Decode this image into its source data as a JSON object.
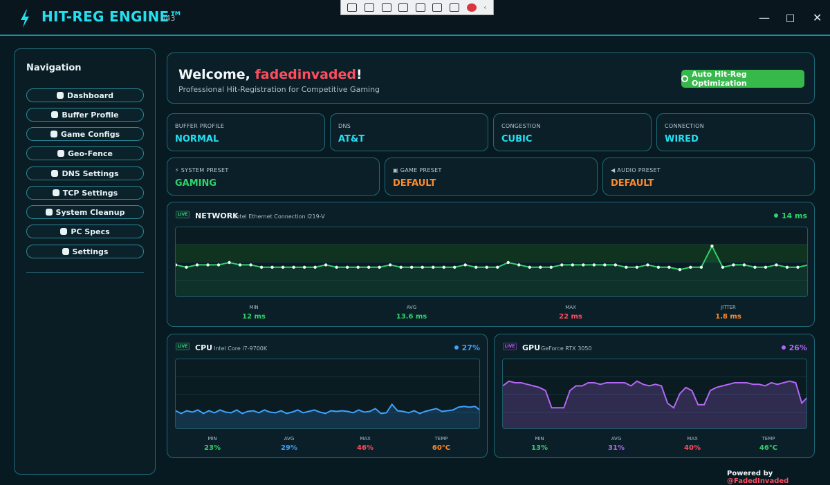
{
  "app": {
    "title": "HIT-REG ENGINE™",
    "version": "v43"
  },
  "window_controls": {
    "minimize": "—",
    "maximize": "□",
    "close": "✕"
  },
  "colors": {
    "accent": "#23e0f0",
    "green": "#2fd36b",
    "orange": "#ff8a2a",
    "red": "#ff4d5e",
    "blue": "#3fa2ff",
    "purple": "#b467f5"
  },
  "nav": {
    "title": "Navigation",
    "items": [
      {
        "label": "Dashboard",
        "icon": "home-icon"
      },
      {
        "label": "Buffer Profile",
        "icon": "gauge-icon"
      },
      {
        "label": "Game Configs",
        "icon": "gamepad-icon"
      },
      {
        "label": "Geo-Fence",
        "icon": "globe-icon"
      },
      {
        "label": "DNS Settings",
        "icon": "dns-icon"
      },
      {
        "label": "TCP Settings",
        "icon": "network-icon"
      },
      {
        "label": "System Cleanup",
        "icon": "broom-icon"
      },
      {
        "label": "PC Specs",
        "icon": "monitor-icon"
      },
      {
        "label": "Settings",
        "icon": "gear-icon"
      }
    ]
  },
  "welcome": {
    "greeting": "Welcome, ",
    "username": "fadedinvaded",
    "suffix": "!",
    "subtitle": "Professional Hit-Registration for Competitive Gaming",
    "button": "Auto Hit-Reg Optimization"
  },
  "stats_row1": [
    {
      "label": "BUFFER PROFILE",
      "value": "NORMAL"
    },
    {
      "label": "DNS",
      "value": "AT&T"
    },
    {
      "label": "CONGESTION",
      "value": "CUBIC"
    },
    {
      "label": "CONNECTION",
      "value": "WIRED"
    }
  ],
  "stats_row2": [
    {
      "label": "SYSTEM PRESET",
      "value": "GAMING"
    },
    {
      "label": "GAME PRESET",
      "value": "DEFAULT"
    },
    {
      "label": "AUDIO PRESET",
      "value": "DEFAULT"
    }
  ],
  "network": {
    "live": "LIVE",
    "title": "NETWORK",
    "subtitle": "Intel Ethernet Connection I219-V",
    "reading": "14 ms",
    "metrics": [
      {
        "label": "MIN",
        "value": "12 ms"
      },
      {
        "label": "AVG",
        "value": "13.6 ms"
      },
      {
        "label": "MAX",
        "value": "22 ms"
      },
      {
        "label": "JITTER",
        "value": "1.8 ms"
      }
    ]
  },
  "cpu": {
    "live": "LIVE",
    "title": "CPU",
    "subtitle": "Intel Core i7-9700K",
    "reading": "27%",
    "metrics": [
      {
        "label": "MIN",
        "value": "23%"
      },
      {
        "label": "AVG",
        "value": "29%"
      },
      {
        "label": "MAX",
        "value": "46%"
      },
      {
        "label": "TEMP",
        "value": "60°C"
      }
    ]
  },
  "gpu": {
    "live": "LIVE",
    "title": "GPU",
    "subtitle": "GeForce RTX 3050",
    "reading": "26%",
    "metrics": [
      {
        "label": "MIN",
        "value": "13%"
      },
      {
        "label": "AVG",
        "value": "31%"
      },
      {
        "label": "MAX",
        "value": "40%"
      },
      {
        "label": "TEMP",
        "value": "46°C"
      }
    ]
  },
  "footer": {
    "prefix": "Powered by ",
    "handle": "@FadedInvaded"
  },
  "chart_data": [
    {
      "type": "line",
      "series": [
        {
          "name": "NETWORK",
          "values": [
            14,
            13,
            14,
            14,
            14,
            15,
            14,
            14,
            13,
            13,
            13,
            13,
            13,
            13,
            14,
            13,
            13,
            13,
            13,
            13,
            14,
            13,
            13,
            13,
            13,
            13,
            13,
            14,
            13,
            13,
            13,
            15,
            14,
            13,
            13,
            13,
            14,
            14,
            14,
            14,
            14,
            14,
            13,
            13,
            14,
            13,
            13,
            12,
            13,
            13,
            22,
            13,
            14,
            14,
            13,
            13,
            14,
            13,
            13,
            14
          ]
        }
      ],
      "ylim": [
        0,
        30
      ],
      "grid": true
    },
    {
      "type": "area",
      "series": [
        {
          "name": "CPU",
          "values": [
            27,
            23,
            27,
            25,
            28,
            23,
            27,
            24,
            28,
            25,
            24,
            28,
            23,
            26,
            27,
            24,
            28,
            25,
            24,
            27,
            23,
            25,
            28,
            24,
            26,
            28,
            25,
            23,
            27,
            26,
            27,
            26,
            24,
            28,
            25,
            26,
            30,
            23,
            24,
            36,
            27,
            26,
            24,
            27,
            23,
            26,
            28,
            30,
            26,
            27,
            28,
            32,
            33,
            32,
            33,
            27
          ]
        }
      ],
      "ylim": [
        0,
        100
      ],
      "grid": true
    },
    {
      "type": "area",
      "series": [
        {
          "name": "GPU",
          "values": [
            28,
            31,
            30,
            30,
            29,
            28,
            27,
            25,
            14,
            14,
            14,
            25,
            28,
            28,
            30,
            30,
            29,
            30,
            30,
            30,
            30,
            28,
            31,
            29,
            28,
            29,
            28,
            17,
            14,
            23,
            27,
            25,
            16,
            16,
            25,
            27,
            28,
            29,
            30,
            30,
            30,
            29,
            29,
            28,
            30,
            29,
            30,
            31,
            30,
            17,
            21
          ]
        }
      ],
      "ylim": [
        0,
        45
      ],
      "grid": true
    }
  ]
}
